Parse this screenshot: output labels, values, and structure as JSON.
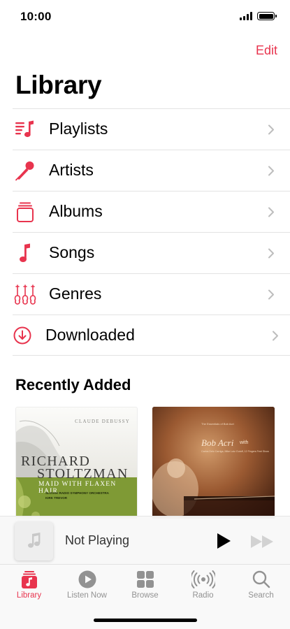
{
  "status_bar": {
    "time": "10:00"
  },
  "header": {
    "edit_label": "Edit",
    "title": "Library"
  },
  "library_items": [
    {
      "label": "Playlists",
      "icon": "playlists-icon"
    },
    {
      "label": "Artists",
      "icon": "microphone-icon"
    },
    {
      "label": "Albums",
      "icon": "album-stack-icon"
    },
    {
      "label": "Songs",
      "icon": "music-note-icon"
    },
    {
      "label": "Genres",
      "icon": "guitars-icon"
    },
    {
      "label": "Downloaded",
      "icon": "download-circle-icon"
    }
  ],
  "recently_added": {
    "title": "Recently Added",
    "albums": [
      {
        "composer": "CLAUDE DEBUSSY",
        "artist_line1": "RICHARD",
        "artist_line2": "STOLTZMAN",
        "album_title": "MAID WITH FLAXEN HAIR",
        "credits_line1": "SLOVAK RADIO SYMPHONY ORCHESTRA",
        "credits_line2": "KIRK TREVOR"
      },
      {
        "subtitle": "The Essentials of Bob Acri",
        "artist": "Bob Acri",
        "artist_suffix": "with",
        "credits": "Carlos Delo Carriga, Mike Lutz Gutoff, 12 Fingers Feet Show"
      }
    ]
  },
  "mini_player": {
    "title": "Not Playing"
  },
  "tabs": [
    {
      "label": "Library",
      "icon": "library-icon",
      "active": true
    },
    {
      "label": "Listen Now",
      "icon": "play-circle-icon",
      "active": false
    },
    {
      "label": "Browse",
      "icon": "grid-icon",
      "active": false
    },
    {
      "label": "Radio",
      "icon": "radio-waves-icon",
      "active": false
    },
    {
      "label": "Search",
      "icon": "search-icon",
      "active": false
    }
  ],
  "colors": {
    "accent": "#e8344e",
    "inactive": "#929292",
    "divider": "#e3e3e3"
  }
}
